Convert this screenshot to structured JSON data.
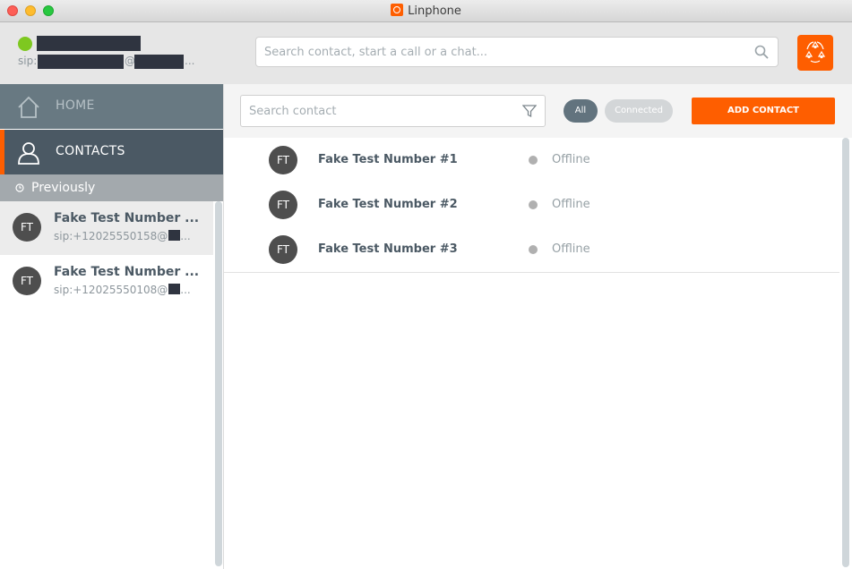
{
  "window": {
    "title": "Linphone"
  },
  "header": {
    "sip_prefix": "sip:",
    "sip_at": "@",
    "sip_ellipsis": "...",
    "search_placeholder": "Search contact, start a call or a chat..."
  },
  "sidebar": {
    "nav": [
      {
        "label": "HOME",
        "icon": "home-icon"
      },
      {
        "label": "CONTACTS",
        "icon": "contact-person-icon"
      }
    ],
    "previously_label": "Previously",
    "recent": [
      {
        "initials": "FT",
        "name": "Fake Test Number ...",
        "sip": "sip:+12025550158@",
        "sip_tail": "..."
      },
      {
        "initials": "FT",
        "name": "Fake Test Number ...",
        "sip": "sip:+12025550108@",
        "sip_tail": "..."
      }
    ]
  },
  "contacts": {
    "search_placeholder": "Search contact",
    "filter_all": "All",
    "filter_connected": "Connected",
    "add_contact": "ADD CONTACT",
    "rows": [
      {
        "initials": "FT",
        "name": "Fake Test Number #1",
        "status": "Offline"
      },
      {
        "initials": "FT",
        "name": "Fake Test Number #2",
        "status": "Offline"
      },
      {
        "initials": "FT",
        "name": "Fake Test Number #3",
        "status": "Offline"
      }
    ]
  },
  "colors": {
    "accent": "#fe5e00",
    "presence_online": "#7ec820",
    "nav_selected": "#4b5964",
    "status_offline": "#b0b0b0"
  }
}
